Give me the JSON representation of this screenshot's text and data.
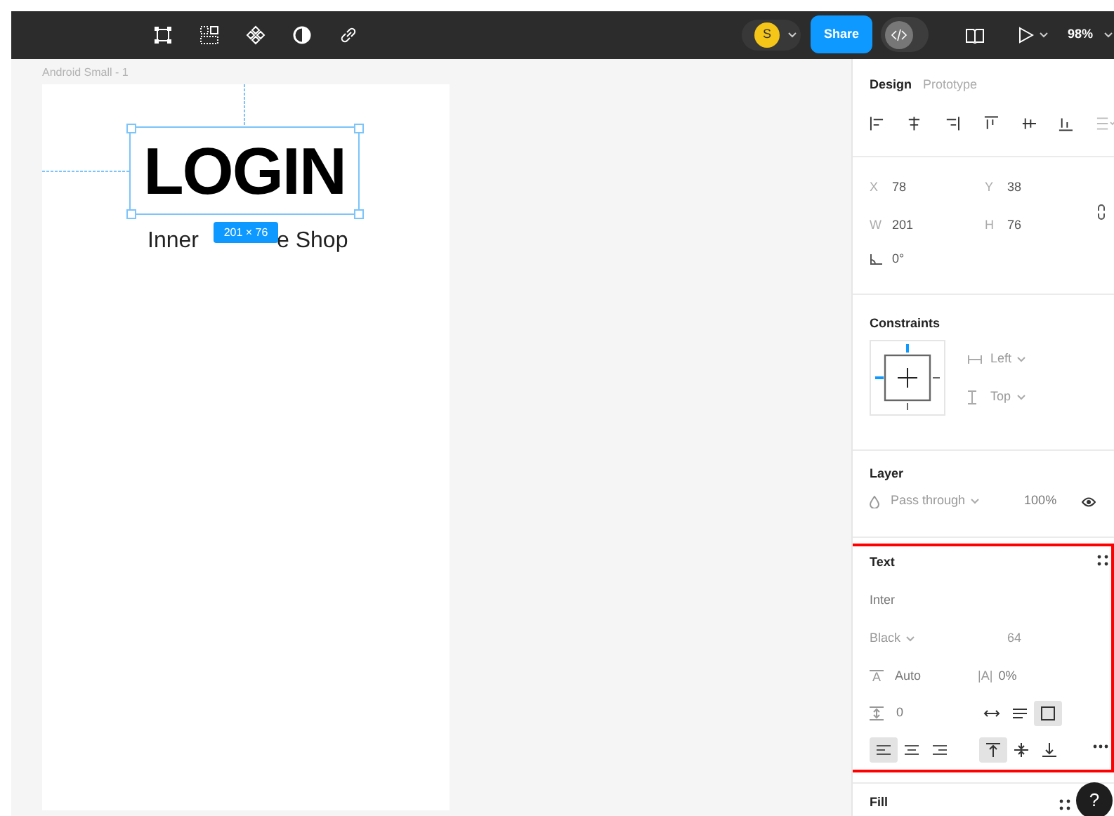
{
  "toolbar": {
    "avatar": "S",
    "share": "Share",
    "zoom": "98%"
  },
  "canvas": {
    "frame_label": "Android Small - 1",
    "title": "LOGIN",
    "subtitle_start": "Inner",
    "subtitle_end": "e Shop",
    "size_badge": "201 × 76",
    "selected": true
  },
  "panel": {
    "tabs": [
      {
        "label": "Design",
        "selected": true
      },
      {
        "label": "Prototype",
        "selected": false
      }
    ],
    "position": [
      {
        "label": "X",
        "value": "78"
      },
      {
        "label": "Y",
        "value": "38"
      },
      {
        "label": "W",
        "value": "201"
      },
      {
        "label": "H",
        "value": "76"
      }
    ],
    "rotation": "0°",
    "constraints": {
      "title": "Constraints",
      "horizontal": "Left",
      "vertical": "Top"
    },
    "layer": {
      "title": "Layer",
      "blend": "Pass through",
      "opacity": "100%"
    },
    "text": {
      "title": "Text",
      "highlighted": true,
      "font": "Inter",
      "weight": "Black",
      "size": "64",
      "line_height_glyph": "A",
      "line_height": "Auto",
      "letter_spacing_glyph": "|A|",
      "letter_spacing": "0%",
      "paragraph_spacing": "0",
      "resizing": [
        {
          "kind": "auto-width",
          "selected": false
        },
        {
          "kind": "auto-height",
          "selected": false
        },
        {
          "kind": "fixed",
          "selected": true
        }
      ],
      "align_horizontal": [
        {
          "kind": "left",
          "selected": true
        },
        {
          "kind": "center",
          "selected": false
        },
        {
          "kind": "right",
          "selected": false
        }
      ],
      "align_vertical": [
        {
          "kind": "top",
          "selected": true
        },
        {
          "kind": "middle",
          "selected": false
        },
        {
          "kind": "bottom",
          "selected": false
        }
      ]
    },
    "fill": {
      "title": "Fill"
    },
    "help": "?"
  }
}
